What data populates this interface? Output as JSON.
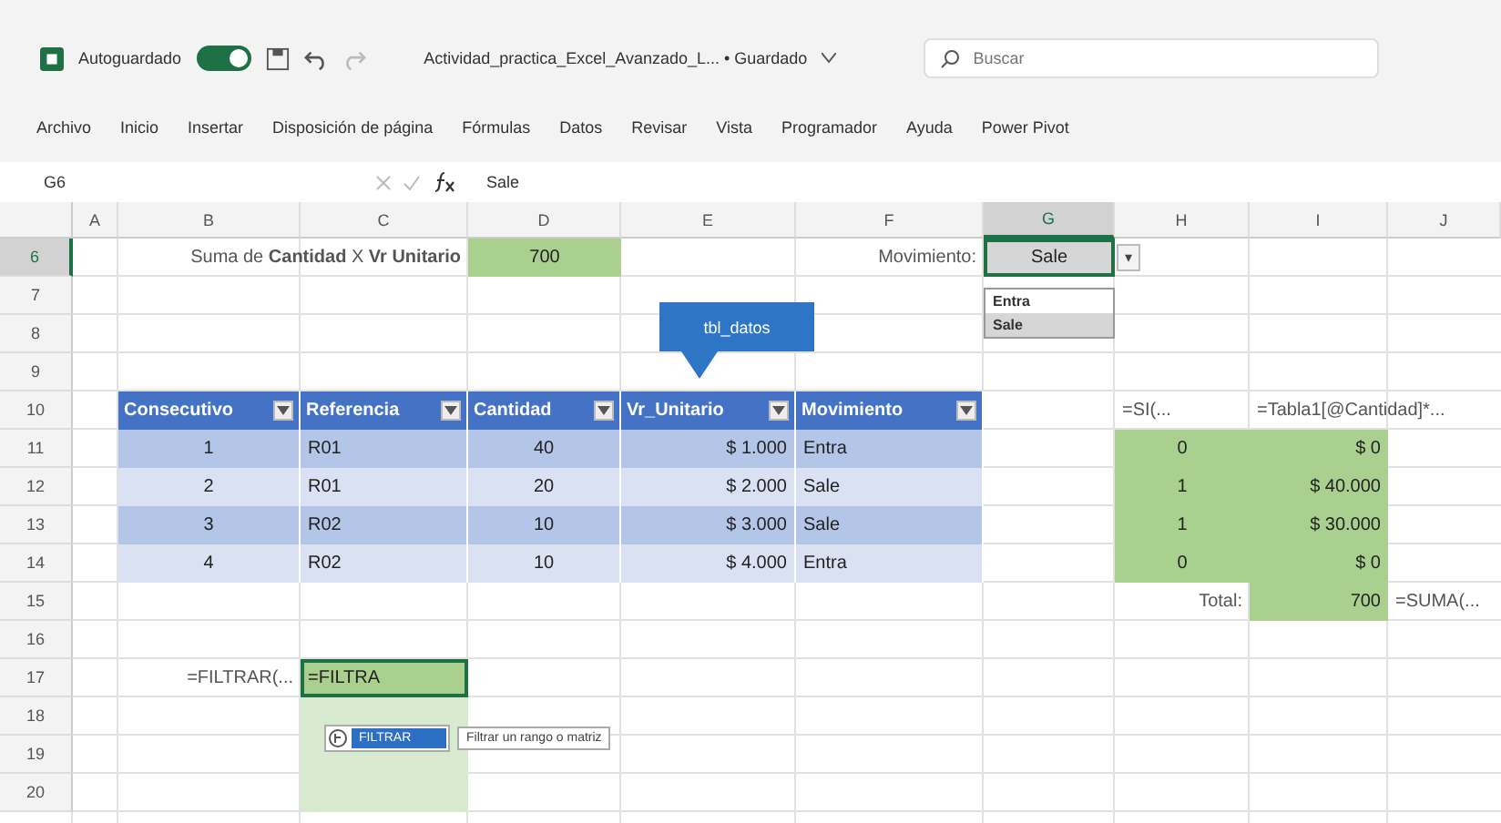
{
  "title_bar": {
    "autosave_label": "Autoguardado",
    "autosave_on": true,
    "document_title": "Actividad_practica_Excel_Avanzado_L... • Guardado",
    "search": {
      "placeholder": "Buscar"
    }
  },
  "ribbon_tabs": [
    "Archivo",
    "Inicio",
    "Insertar",
    "Disposición de página",
    "Fórmulas",
    "Datos",
    "Revisar",
    "Vista",
    "Programador",
    "Ayuda",
    "Power Pivot"
  ],
  "formula_bar": {
    "name_box": "G6",
    "formula": "Sale"
  },
  "columns": [
    {
      "label": "A",
      "selected": false
    },
    {
      "label": "B",
      "selected": false
    },
    {
      "label": "C",
      "selected": false
    },
    {
      "label": "D",
      "selected": false
    },
    {
      "label": "E",
      "selected": false
    },
    {
      "label": "F",
      "selected": false
    },
    {
      "label": "G",
      "selected": true
    },
    {
      "label": "H",
      "selected": false
    },
    {
      "label": "I",
      "selected": false
    },
    {
      "label": "J",
      "selected": false
    }
  ],
  "rows": [
    {
      "number": "6",
      "selected": true,
      "cells": [
        {
          "kind": "blank"
        },
        {
          "kind": "blank"
        },
        {
          "kind": "label_right",
          "text": "Suma de **Cantidad** X **Vr Unitario**"
        },
        {
          "kind": "green",
          "text": "700"
        },
        {
          "kind": "blank"
        },
        {
          "kind": "label_right",
          "text": "Movimiento:"
        },
        {
          "kind": "selected",
          "text": "Sale"
        },
        {
          "kind": "dropdown",
          "text": "▾"
        },
        {
          "kind": "blank"
        },
        {
          "kind": "blank"
        }
      ]
    },
    {
      "number": "7",
      "selected": false,
      "cells": [
        {
          "kind": "blank"
        },
        {
          "kind": "blank"
        },
        {
          "kind": "blank"
        },
        {
          "kind": "blank"
        },
        {
          "kind": "blank"
        },
        {
          "kind": "blank"
        },
        {
          "kind": "blank"
        },
        {
          "kind": "blank"
        },
        {
          "kind": "blank"
        },
        {
          "kind": "blank"
        }
      ]
    },
    {
      "number": "8",
      "selected": false,
      "cells": [
        {
          "kind": "blank"
        },
        {
          "kind": "blank"
        },
        {
          "kind": "blank"
        },
        {
          "kind": "blank"
        },
        {
          "kind": "blank"
        },
        {
          "kind": "blank"
        },
        {
          "kind": "blank"
        },
        {
          "kind": "blank"
        },
        {
          "kind": "blank"
        },
        {
          "kind": "blank"
        }
      ]
    },
    {
      "number": "9",
      "selected": false,
      "cells": [
        {
          "kind": "blank"
        },
        {
          "kind": "blank"
        },
        {
          "kind": "blank"
        },
        {
          "kind": "blank"
        },
        {
          "kind": "blank"
        },
        {
          "kind": "blank"
        },
        {
          "kind": "blank"
        },
        {
          "kind": "blank"
        },
        {
          "kind": "blank"
        },
        {
          "kind": "blank"
        }
      ]
    },
    {
      "number": "10",
      "selected": false,
      "cells": [
        {
          "kind": "blank"
        },
        {
          "kind": "header",
          "text": "Consecutivo"
        },
        {
          "kind": "header",
          "text": "Referencia"
        },
        {
          "kind": "header",
          "text": "Cantidad"
        },
        {
          "kind": "header",
          "text": "Vr_Unitario"
        },
        {
          "kind": "header",
          "text": "Movimiento"
        },
        {
          "kind": "blank"
        },
        {
          "kind": "label_left",
          "text": "=SI(..."
        },
        {
          "kind": "label_left",
          "text": "=Tabla1[@Cantidad]*..."
        },
        {
          "kind": "blank"
        }
      ]
    },
    {
      "number": "11",
      "selected": false,
      "cells": [
        {
          "kind": "blank"
        },
        {
          "kind": "band_dark",
          "text": "1"
        },
        {
          "kind": "band_dark",
          "text": "R01"
        },
        {
          "kind": "band_dark",
          "text": "40"
        },
        {
          "kind": "band_dark",
          "text": "$ 1.000"
        },
        {
          "kind": "band_dark",
          "text": "Entra"
        },
        {
          "kind": "blank"
        },
        {
          "kind": "green",
          "text": "0"
        },
        {
          "kind": "green",
          "text": "$ 0"
        },
        {
          "kind": "blank"
        }
      ]
    },
    {
      "number": "12",
      "selected": false,
      "cells": [
        {
          "kind": "blank"
        },
        {
          "kind": "band_light",
          "text": "2"
        },
        {
          "kind": "band_light",
          "text": "R01"
        },
        {
          "kind": "band_light",
          "text": "20"
        },
        {
          "kind": "band_light",
          "text": "$ 2.000"
        },
        {
          "kind": "band_light",
          "text": "Sale"
        },
        {
          "kind": "blank"
        },
        {
          "kind": "green",
          "text": "1"
        },
        {
          "kind": "green",
          "text": "$ 40.000"
        },
        {
          "kind": "blank"
        }
      ]
    },
    {
      "number": "13",
      "selected": false,
      "cells": [
        {
          "kind": "blank"
        },
        {
          "kind": "band_dark",
          "text": "3"
        },
        {
          "kind": "band_dark",
          "text": "R02"
        },
        {
          "kind": "band_dark",
          "text": "10"
        },
        {
          "kind": "band_dark",
          "text": "$ 3.000"
        },
        {
          "kind": "band_dark",
          "text": "Sale"
        },
        {
          "kind": "blank"
        },
        {
          "kind": "green",
          "text": "1"
        },
        {
          "kind": "green",
          "text": "$ 30.000"
        },
        {
          "kind": "blank"
        }
      ]
    },
    {
      "number": "14",
      "selected": false,
      "cells": [
        {
          "kind": "blank"
        },
        {
          "kind": "band_light",
          "text": "4"
        },
        {
          "kind": "band_light",
          "text": "R02"
        },
        {
          "kind": "band_light",
          "text": "10"
        },
        {
          "kind": "band_light",
          "text": "$ 4.000"
        },
        {
          "kind": "band_light",
          "text": "Entra"
        },
        {
          "kind": "blank"
        },
        {
          "kind": "green",
          "text": "0"
        },
        {
          "kind": "green",
          "text": "$ 0"
        },
        {
          "kind": "blank"
        }
      ]
    },
    {
      "number": "15",
      "selected": false,
      "cells": [
        {
          "kind": "blank"
        },
        {
          "kind": "blank"
        },
        {
          "kind": "blank"
        },
        {
          "kind": "blank"
        },
        {
          "kind": "blank"
        },
        {
          "kind": "blank"
        },
        {
          "kind": "blank"
        },
        {
          "kind": "label_right",
          "text": "Total:"
        },
        {
          "kind": "green",
          "text": "700"
        },
        {
          "kind": "label_left",
          "text": "=SUMA(..."
        }
      ]
    },
    {
      "number": "16",
      "selected": false,
      "cells": [
        {
          "kind": "blank"
        },
        {
          "kind": "blank"
        },
        {
          "kind": "blank"
        },
        {
          "kind": "blank"
        },
        {
          "kind": "blank"
        },
        {
          "kind": "blank"
        },
        {
          "kind": "blank"
        },
        {
          "kind": "blank"
        },
        {
          "kind": "blank"
        },
        {
          "kind": "blank"
        }
      ]
    },
    {
      "number": "17",
      "selected": false,
      "cells": [
        {
          "kind": "blank"
        },
        {
          "kind": "label_right",
          "text": "=FILTRAR(..."
        },
        {
          "kind": "editing",
          "text": "=FILTRA"
        },
        {
          "kind": "blank"
        },
        {
          "kind": "blank"
        },
        {
          "kind": "blank"
        },
        {
          "kind": "blank"
        },
        {
          "kind": "blank"
        },
        {
          "kind": "blank"
        },
        {
          "kind": "blank"
        }
      ]
    },
    {
      "number": "18",
      "selected": false,
      "cells": [
        {
          "kind": "blank"
        },
        {
          "kind": "blank"
        },
        {
          "kind": "tint"
        },
        {
          "kind": "blank"
        },
        {
          "kind": "blank"
        },
        {
          "kind": "blank"
        },
        {
          "kind": "blank"
        },
        {
          "kind": "blank"
        },
        {
          "kind": "blank"
        },
        {
          "kind": "blank"
        }
      ]
    },
    {
      "number": "19",
      "selected": false,
      "cells": [
        {
          "kind": "blank"
        },
        {
          "kind": "blank"
        },
        {
          "kind": "tint"
        },
        {
          "kind": "blank"
        },
        {
          "kind": "blank"
        },
        {
          "kind": "blank"
        },
        {
          "kind": "blank"
        },
        {
          "kind": "blank"
        },
        {
          "kind": "blank"
        },
        {
          "kind": "blank"
        }
      ]
    },
    {
      "number": "20",
      "selected": false,
      "cells": [
        {
          "kind": "blank"
        },
        {
          "kind": "blank"
        },
        {
          "kind": "tint"
        },
        {
          "kind": "blank"
        },
        {
          "kind": "blank"
        },
        {
          "kind": "blank"
        },
        {
          "kind": "blank"
        },
        {
          "kind": "blank"
        },
        {
          "kind": "blank"
        },
        {
          "kind": "blank"
        }
      ]
    }
  ],
  "table_name_tooltip": "tbl_datos",
  "validation_list": [
    {
      "label": "Entra",
      "selected": false
    },
    {
      "label": "Sale",
      "selected": true
    }
  ],
  "autocomplete": {
    "items": [
      {
        "label": "FILTRAR",
        "selected": true
      }
    ],
    "description": "Filtrar un rango o matriz"
  }
}
